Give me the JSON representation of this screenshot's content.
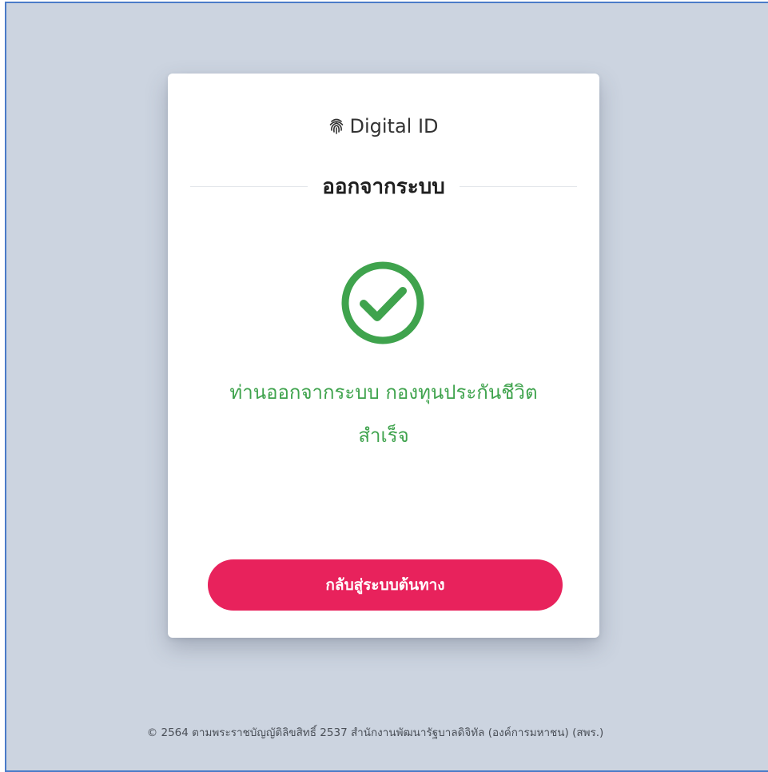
{
  "brand": {
    "name": "Digital ID",
    "icon": "fingerprint-icon"
  },
  "title": "ออกจากระบบ",
  "status": {
    "icon": "check-circle-icon",
    "color": "#3fa34d",
    "line1": "ท่านออกจากระบบ กองทุนประกันชีวิต",
    "line2": "สำเร็จ"
  },
  "back_button": {
    "label": "กลับสู่ระบบต้นทาง",
    "color": "#e8225c"
  },
  "footer": {
    "text": "© 2564 ตามพระราชบัญญัติลิขสิทธิ์ 2537 สำนักงานพัฒนารัฐบาลดิจิทัล (องค์การมหาชน) (สพร.)"
  }
}
